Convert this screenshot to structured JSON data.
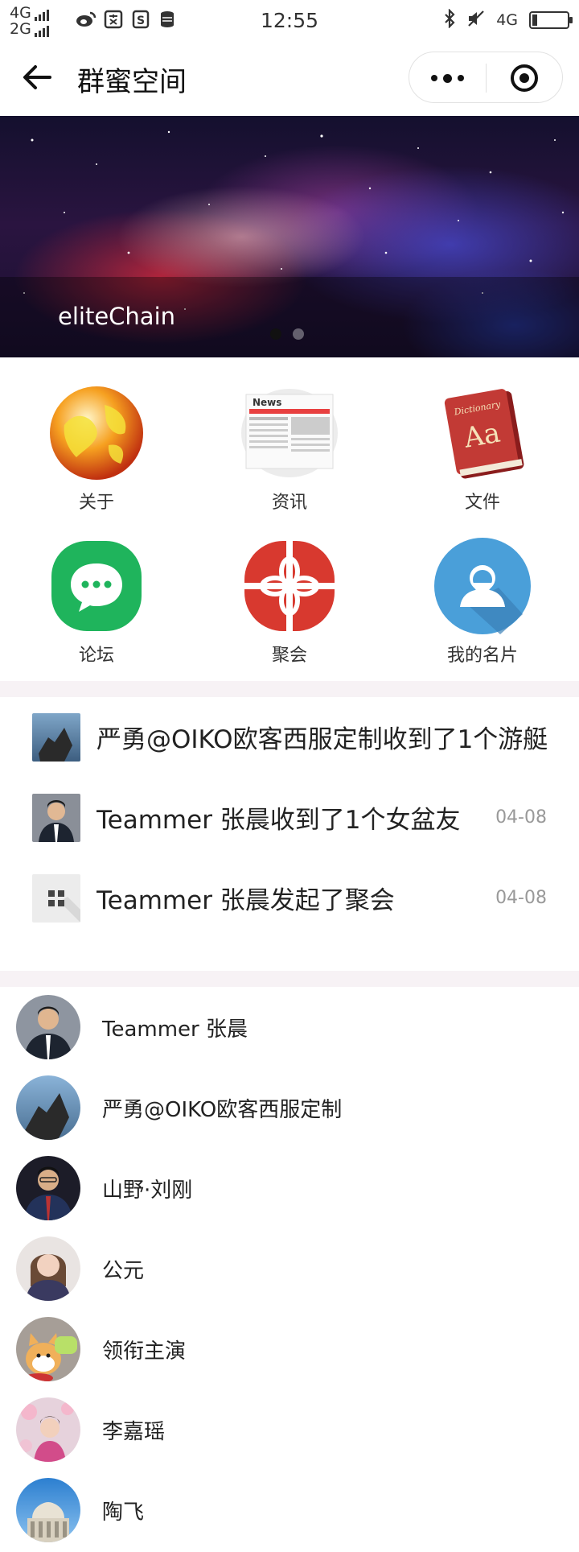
{
  "status_bar": {
    "signal_1": "4G",
    "signal_2": "2G",
    "time": "12:55",
    "network": "4G"
  },
  "navbar": {
    "title": "群蜜空间"
  },
  "banner": {
    "caption": "eliteChain",
    "active_slide": 1,
    "slide_count": 2
  },
  "grid": [
    {
      "label": "关于",
      "icon": "globe-icon"
    },
    {
      "label": "资讯",
      "icon": "newspaper-icon"
    },
    {
      "label": "文件",
      "icon": "dictionary-icon"
    },
    {
      "label": "论坛",
      "icon": "chat-bubble-icon"
    },
    {
      "label": "聚会",
      "icon": "gift-icon"
    },
    {
      "label": "我的名片",
      "icon": "user-card-icon"
    }
  ],
  "news": [
    {
      "text": "严勇@OIKO欧客西服定制收到了1个游艇",
      "date": ""
    },
    {
      "text": "Teammer 张晨收到了1个女盆友",
      "date": "04-08"
    },
    {
      "text": "Teammer 张晨发起了聚会",
      "date": "04-08"
    }
  ],
  "members": [
    {
      "name": "Teammer 张晨"
    },
    {
      "name": "严勇@OIKO欧客西服定制"
    },
    {
      "name": "山野·刘刚"
    },
    {
      "name": "公元"
    },
    {
      "name": "领衔主演"
    },
    {
      "name": "李嘉瑶"
    },
    {
      "name": "陶飞"
    }
  ],
  "colors": {
    "separator": "#f7f2f5",
    "forum_green": "#1fb45c",
    "gift_red": "#d8392f",
    "card_blue": "#4a9fd9"
  }
}
